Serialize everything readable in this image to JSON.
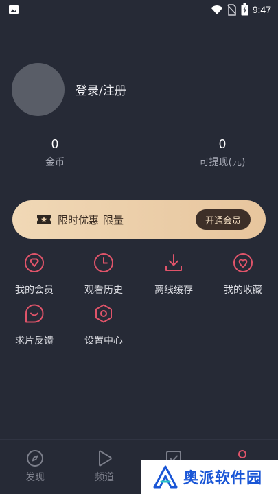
{
  "status_bar": {
    "time": "9:47",
    "icons": [
      "image-icon",
      "wifi-icon",
      "no-sim-icon",
      "battery-charging-icon"
    ]
  },
  "profile": {
    "login_text": "登录/注册"
  },
  "stats": {
    "coins": {
      "value": "0",
      "label": "金币"
    },
    "cash": {
      "value": "0",
      "label": "可提现(元)"
    }
  },
  "vip_banner": {
    "icon": "ticket-star-icon",
    "text": "限时优惠",
    "limit": "限量",
    "button": "开通会员"
  },
  "menu": [
    {
      "label": "我的会员",
      "icon": "diamond-icon"
    },
    {
      "label": "观看历史",
      "icon": "clock-icon"
    },
    {
      "label": "离线缓存",
      "icon": "download-icon"
    },
    {
      "label": "我的收藏",
      "icon": "heart-icon"
    },
    {
      "label": "求片反馈",
      "icon": "feedback-icon"
    },
    {
      "label": "设置中心",
      "icon": "settings-icon"
    }
  ],
  "bottom_nav": [
    {
      "label": "发现",
      "icon": "compass-icon"
    },
    {
      "label": "频道",
      "icon": "play-icon"
    },
    {
      "label": "",
      "icon": "check-box-icon"
    },
    {
      "label": "",
      "icon": "person-icon"
    }
  ],
  "watermark": {
    "text": "奥派软件园"
  },
  "colors": {
    "background": "#262a36",
    "accent": "#e0546a",
    "vip_gold": "#eccfa9",
    "vip_button": "#3d2f28"
  }
}
